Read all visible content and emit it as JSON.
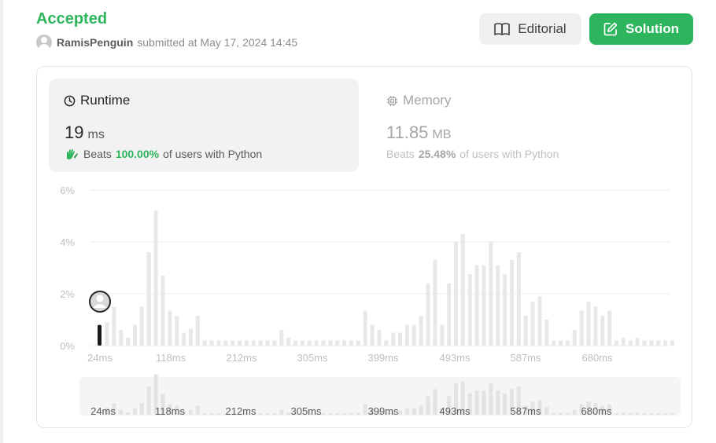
{
  "submission": {
    "status": "Accepted",
    "username": "RamisPenguin",
    "submitted_text": "submitted at May 17, 2024 14:45"
  },
  "buttons": {
    "editorial": "Editorial",
    "solution": "Solution"
  },
  "runtime": {
    "title": "Runtime",
    "value": "19",
    "unit": "ms",
    "beats_prefix": "Beats",
    "beats_pct": "100.00%",
    "beats_suffix": "of users with Python"
  },
  "memory": {
    "title": "Memory",
    "value": "11.85",
    "unit": "MB",
    "beats_prefix": "Beats",
    "beats_pct": "25.48%",
    "beats_suffix": "of users with Python"
  },
  "colors": {
    "accent_green": "#2db55d",
    "bar": "#e8e8e8",
    "highlight_bar": "#1a1a1a"
  },
  "icons": {
    "editorial": "book-open-icon",
    "solution": "edit-icon",
    "runtime": "clock-icon",
    "memory": "chip-icon",
    "beats": "clapping-hands-icon"
  },
  "chart_data": {
    "type": "bar",
    "ylim": [
      0,
      6
    ],
    "y_ticks": [
      "6%",
      "4%",
      "2%",
      "0%"
    ],
    "y_tick_values": [
      6,
      4,
      2,
      0
    ],
    "x_ticks": [
      "24ms",
      "118ms",
      "212ms",
      "305ms",
      "399ms",
      "493ms",
      "587ms",
      "680ms"
    ],
    "grid": true,
    "values": [
      0.9,
      1.5,
      0.6,
      0.3,
      0.8,
      1.5,
      3.6,
      5.2,
      2.7,
      1.35,
      1.15,
      0.5,
      0.65,
      1.15,
      0.2,
      0.2,
      0.2,
      0.2,
      0.2,
      0.2,
      0.2,
      0.2,
      0.2,
      0.2,
      0.2,
      0.6,
      0.3,
      0.2,
      0.2,
      0.2,
      0.2,
      0.2,
      0.2,
      0.2,
      0.2,
      0.2,
      0.2,
      1.35,
      0.8,
      0.6,
      0.2,
      0.5,
      0.5,
      0.8,
      0.8,
      1.15,
      2.4,
      3.3,
      0.8,
      2.4,
      4.0,
      4.3,
      2.75,
      3.1,
      3.1,
      4.0,
      3.1,
      2.75,
      3.3,
      3.6,
      1.15,
      1.7,
      1.9,
      1.0,
      0.2,
      0.2,
      0.2,
      0.6,
      1.35,
      1.7,
      1.5,
      1.15,
      1.35,
      0.2,
      0.3,
      0.2,
      0.3,
      0.2,
      0.2,
      0.2,
      0.2,
      0.2
    ],
    "highlight": {
      "x_label": "19ms",
      "value": 0.8
    }
  }
}
